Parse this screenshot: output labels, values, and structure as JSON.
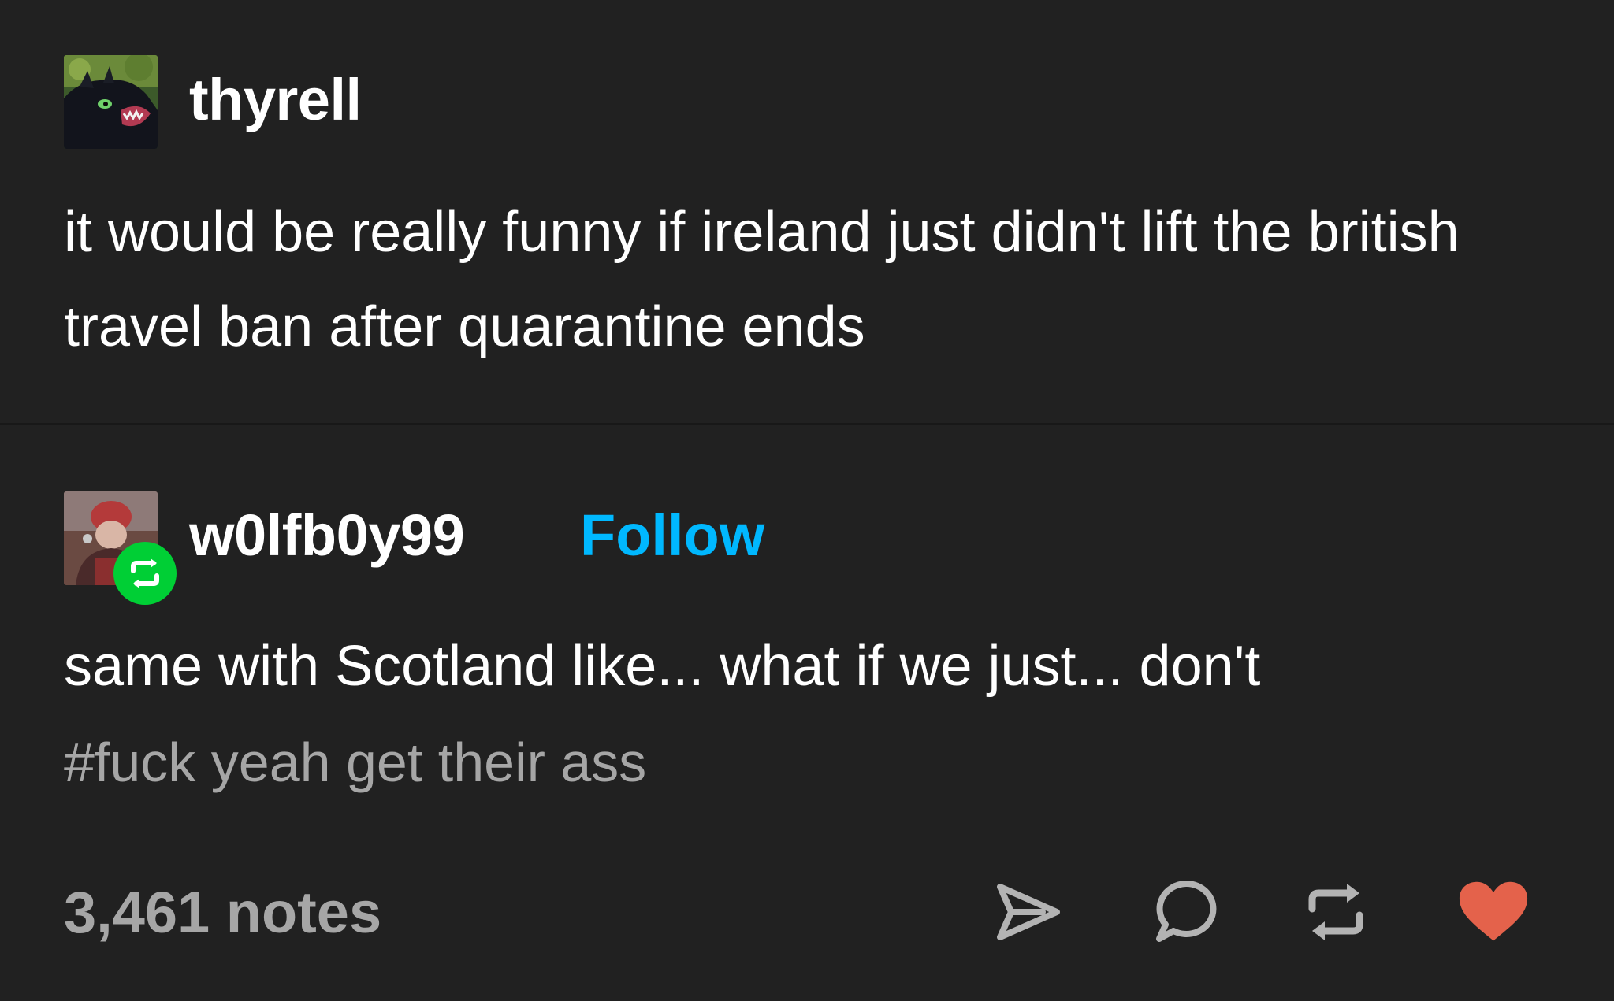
{
  "original_post": {
    "username": "thyrell",
    "body": "it would be really funny if ireland just didn't lift the british travel ban after quarantine ends"
  },
  "reblog": {
    "username": "w0lfb0y99",
    "follow_label": "Follow",
    "body": "same with Scotland like... what if we just... don't",
    "tags": "#fuck yeah get their ass"
  },
  "footer": {
    "notes": "3,461 notes",
    "icons": [
      "share-icon",
      "reply-icon",
      "reblog-icon",
      "like-icon"
    ]
  },
  "colors": {
    "background": "#212121",
    "text": "#ffffff",
    "muted": "#a6a6a6",
    "follow": "#00b8ff",
    "reblog_badge": "#00cf35",
    "like": "#e4624b"
  }
}
